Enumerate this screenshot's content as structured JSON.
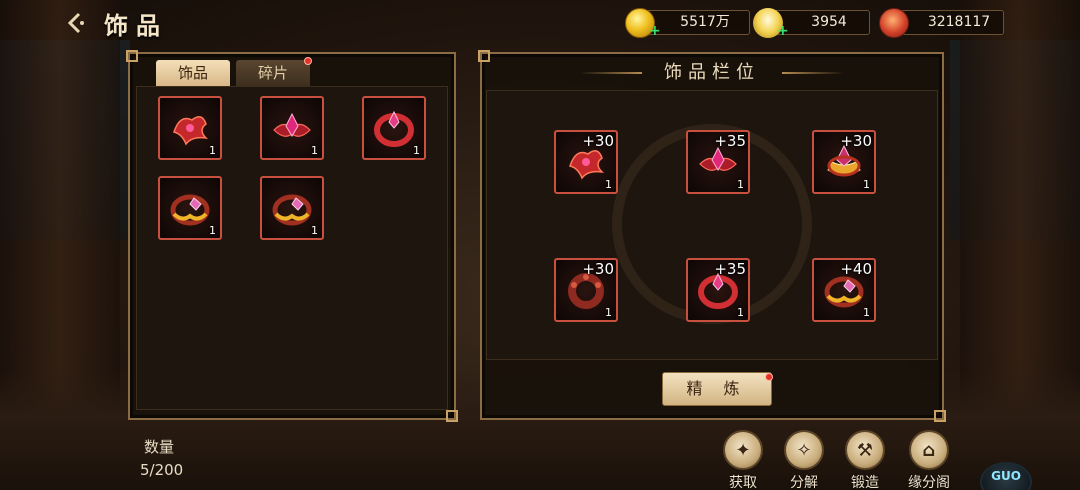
{
  "header": {
    "title": "饰品",
    "back_icon": "back-arrow-icon"
  },
  "resources": [
    {
      "name": "gold-coin",
      "icon": "gold-coin-icon",
      "value": "5517万",
      "has_plus": true
    },
    {
      "name": "yuanbao-ingot",
      "icon": "gold-ingot-icon",
      "value": "3954",
      "has_plus": true
    },
    {
      "name": "token",
      "icon": "red-token-icon",
      "value": "3218117",
      "has_plus": false
    }
  ],
  "inventory": {
    "tabs": [
      {
        "label": "饰品",
        "active": true,
        "red_dot": false
      },
      {
        "label": "碎片",
        "active": false,
        "red_dot": true
      }
    ],
    "items": [
      {
        "icon": "red-ribbon-crest-icon",
        "count": "1"
      },
      {
        "icon": "crimson-crystal-brooch-icon",
        "count": "1"
      },
      {
        "icon": "red-ring-icon",
        "count": "1"
      },
      {
        "icon": "gold-jade-ring-icon",
        "count": "1"
      },
      {
        "icon": "gold-jade-ring-icon",
        "count": "1"
      }
    ]
  },
  "equipment": {
    "title": "饰品栏位",
    "slots": [
      {
        "icon": "red-ribbon-crest-icon",
        "enhance": "+30",
        "count": "1"
      },
      {
        "icon": "crimson-crystal-brooch-icon",
        "enhance": "+35",
        "count": "1"
      },
      {
        "icon": "gold-crown-gem-icon",
        "enhance": "+30",
        "count": "1"
      },
      {
        "icon": "red-bead-ring-icon",
        "enhance": "+30",
        "count": "1"
      },
      {
        "icon": "red-ring-icon",
        "enhance": "+35",
        "count": "1"
      },
      {
        "icon": "gold-jade-ring-icon",
        "enhance": "+40",
        "count": "1"
      }
    ],
    "refine_label": "精 炼"
  },
  "quantity": {
    "label": "数量",
    "value": "5/200"
  },
  "actions": [
    {
      "label": "获取",
      "icon": "obtain-icon"
    },
    {
      "label": "分解",
      "icon": "decompose-icon"
    },
    {
      "label": "锻造",
      "icon": "forge-hammer-icon"
    },
    {
      "label": "缘分阁",
      "icon": "pavilion-icon"
    }
  ],
  "colors": {
    "accent": "#c9503e",
    "panel_border": "#8b6c45",
    "button": "#e3c99b",
    "alert": "#e3322a"
  }
}
